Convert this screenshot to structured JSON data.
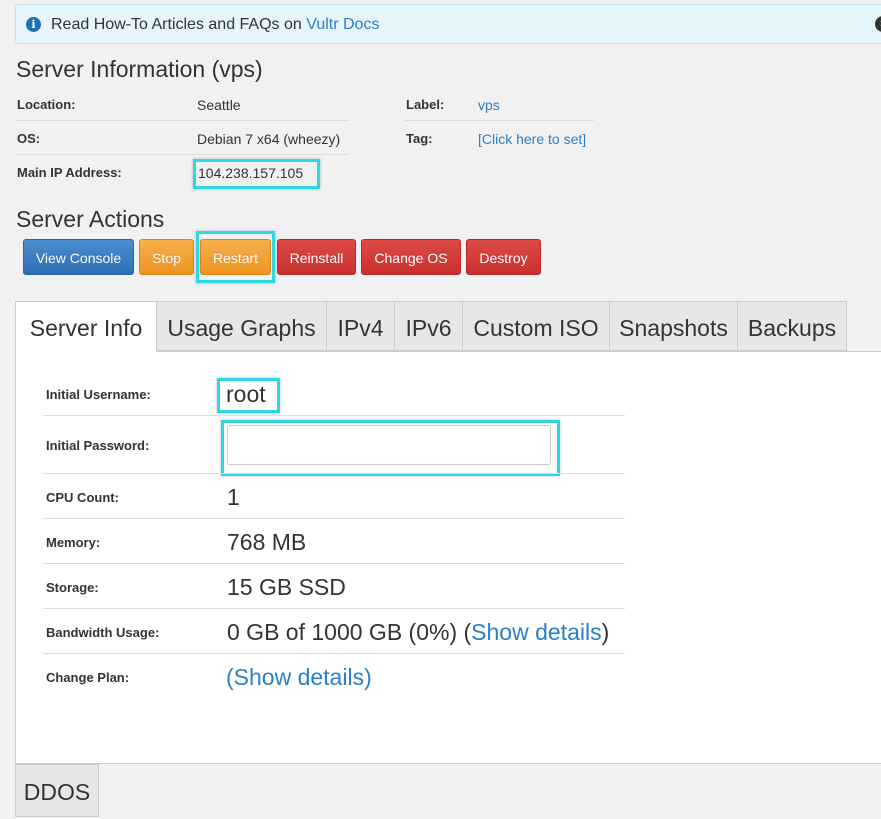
{
  "banner": {
    "text": "Read How-To Articles and FAQs on ",
    "link": "Vultr Docs",
    "info_icon": "i",
    "close_icon": "×"
  },
  "server_information": {
    "title": "Server Information (vps)",
    "location_label": "Location:",
    "location_value": "Seattle",
    "os_label": "OS:",
    "os_value": "Debian 7 x64 (wheezy)",
    "ip_label": "Main IP Address:",
    "ip_value": "104.238.157.105",
    "label_label": "Label:",
    "label_value": "vps",
    "tag_label": "Tag:",
    "tag_value": "[Click here to set]"
  },
  "server_actions": {
    "title": "Server Actions",
    "buttons": [
      "View Console",
      "Stop",
      "Restart",
      "Reinstall",
      "Change OS",
      "Destroy"
    ]
  },
  "tabs": [
    "Server Info",
    "Usage Graphs",
    "IPv4",
    "IPv6",
    "Custom ISO",
    "Snapshots",
    "Backups"
  ],
  "active_tab": "Server Info",
  "details": {
    "username_label": "Initial Username:",
    "username_value": "root",
    "password_label": "Initial Password:",
    "password_value": "",
    "cpu_label": "CPU Count:",
    "cpu_value": "1",
    "memory_label": "Memory:",
    "memory_value": "768 MB",
    "storage_label": "Storage:",
    "storage_value": "15 GB SSD",
    "bandwidth_label": "Bandwidth Usage:",
    "bandwidth_value": "0 GB of 1000 GB (0%) (",
    "bandwidth_link": "Show details",
    "bandwidth_close": ")",
    "plan_label": "Change Plan:",
    "plan_link": "(Show details)"
  },
  "bottom_tab": "DDOS",
  "colors": {
    "highlight": "#2fd7e3",
    "link": "#2a7fc6",
    "button_blue": "#3a7fc2",
    "button_orange": "#f0a030",
    "button_red": "#d03a37"
  }
}
